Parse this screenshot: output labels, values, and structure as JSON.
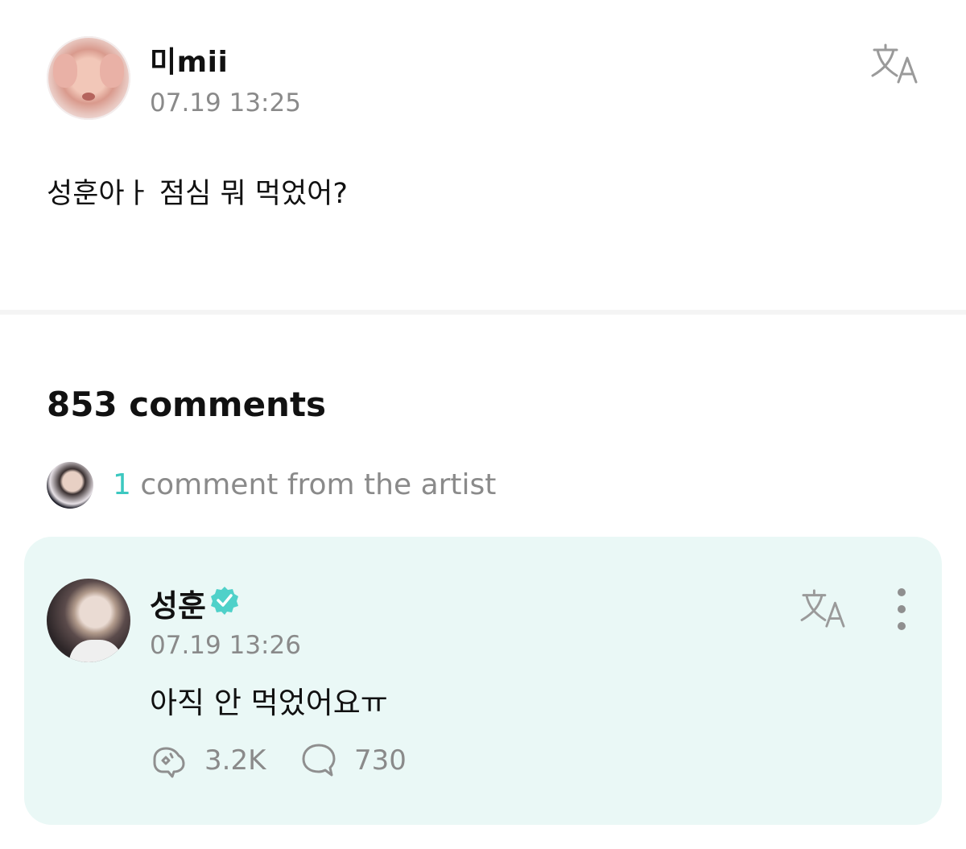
{
  "post": {
    "author": "미mii",
    "time": "07.19 13:25",
    "text": "성훈아ㅏ 점심 뭐 먹었어?"
  },
  "comments": {
    "count_label": "853 comments",
    "artist_count": "1",
    "artist_label": " comment from the artist"
  },
  "artist_comment": {
    "author": "성훈",
    "time": "07.19 13:26",
    "text": "아직 안 먹었어요ㅠ",
    "likes": "3.2K",
    "replies": "730"
  },
  "icons": {
    "translate": "translate-icon",
    "verified": "verified-badge-icon",
    "more": "more-vertical-icon",
    "like": "like-icon",
    "reply": "reply-bubble-icon"
  },
  "colors": {
    "accent": "#3cc8c0",
    "card_background": "#eaf8f6",
    "muted_text": "#8a8a8a",
    "icon_gray": "#8f8f8f"
  }
}
